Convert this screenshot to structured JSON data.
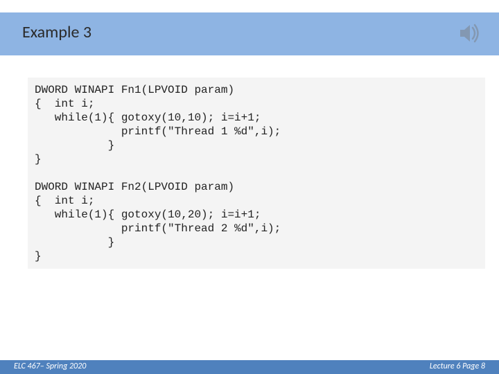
{
  "title": "Example 3",
  "code": "DWORD WINAPI Fn1(LPVOID param)\n{  int i;\n   while(1){ gotoxy(10,10); i=i+1;\n             printf(\"Thread 1 %d\",i);\n           }\n}\n\nDWORD WINAPI Fn2(LPVOID param)\n{  int i;\n   while(1){ gotoxy(10,20); i=i+1;\n             printf(\"Thread 2 %d\",i);\n           }\n}",
  "footer": {
    "left": "ELC 467– Spring 2020",
    "right": "Lecture 6 Page 8"
  },
  "icons": {
    "audio": "audio-icon"
  }
}
